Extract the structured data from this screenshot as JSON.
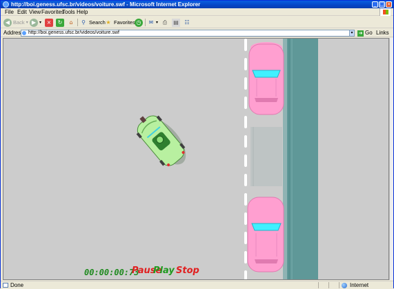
{
  "window": {
    "title": "http://boi.geness.ufsc.br/videos/voiture.swf - Microsoft Internet Explorer",
    "controls": {
      "minimize": "_",
      "maximize": "□",
      "close": "×"
    }
  },
  "menu": {
    "items": [
      {
        "label": "File"
      },
      {
        "label": "Edit"
      },
      {
        "label": "View"
      },
      {
        "label": "Favorites"
      },
      {
        "label": "Tools"
      },
      {
        "label": "Help"
      }
    ]
  },
  "toolbar": {
    "back_label": "Back",
    "search_label": "Search",
    "favorites_label": "Favorites"
  },
  "address": {
    "label": "Address",
    "url": "http://boi.geness.ufsc.br/videos/voiture.swf",
    "go_label": "Go",
    "links_label": "Links",
    "dropdown_glyph": "▾"
  },
  "flash": {
    "timer": "00:00:00:73",
    "pause_label": "Pause",
    "play_label": "Play",
    "stop_label": "Stop",
    "colors": {
      "background": "#cccccc",
      "road_water": "#5f9898",
      "parked_car": "#ff9fd0",
      "windshield": "#40f0ff",
      "player_car": "#b8f0a0",
      "timer": "#1f8a1f",
      "pause": "#e02020",
      "play": "#1f9a1f",
      "stop": "#e02020"
    }
  },
  "status": {
    "text": "Done",
    "zone": "Internet"
  }
}
